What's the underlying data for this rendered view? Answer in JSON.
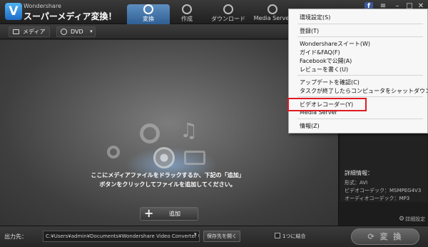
{
  "app": {
    "brand_small": "Wondershare",
    "brand_main": "スーパーメディア変換！",
    "logo_letter": "V"
  },
  "tabs": [
    {
      "label": "変換",
      "active": true
    },
    {
      "label": "作成",
      "active": false
    },
    {
      "label": "ダウンロード",
      "active": false
    },
    {
      "label": "Media Server",
      "active": false
    }
  ],
  "window_controls": {
    "facebook": "f",
    "minimize": "–",
    "maximize": "□",
    "close": "✕"
  },
  "toolbar": {
    "media_label": "メディア",
    "dvd_label": "DVD",
    "dropdown_caret": "▾"
  },
  "workspace": {
    "hint_line1": "ここにメディアファイルをドラックするか、下記の「追加」",
    "hint_line2": "ボタンをクリックしてファイルを追加してください。",
    "add_label": "追加"
  },
  "details": {
    "title": "詳細情報：",
    "format": "形式：AVI",
    "video_codec": "ビデオコーデック：MSMPEG4V3",
    "audio_codec": "オーディオコーデック：MP3",
    "settings_link": "詳細設定"
  },
  "bottom": {
    "output_label": "出力先：",
    "output_path": "C:¥Users¥admin¥Documents¥Wondershare Video Converter Ultimate¥Ou",
    "save_dest_label": "保存先を開く",
    "merge_label": "1つに結合",
    "convert_label": "変 換"
  },
  "menu": {
    "items": [
      "環境設定(S)",
      "登録(T)",
      "Wondershareスイート(W)",
      "ガイド&FAQ(F)",
      "Facebookで公開(A)",
      "レビューを書く(U)",
      "アップデートを確認(C)",
      "タスクが終了したらコンピュータをシャットダウン(X)",
      "ビデオレコーダー(Y)",
      "Media Server",
      "情報(Z)"
    ],
    "highlight_color": "#e11b22"
  },
  "colors": {
    "active_tab": "#3f73a8",
    "menu_bg": "#f7f7f7"
  }
}
